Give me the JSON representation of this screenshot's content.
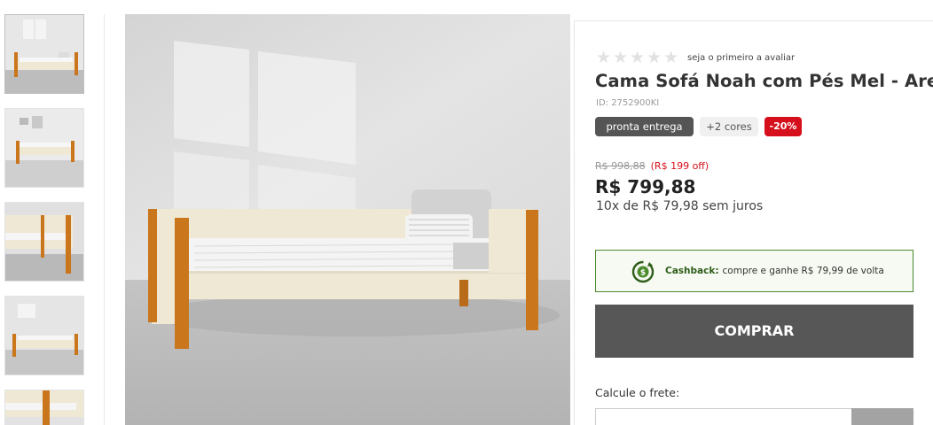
{
  "gallery": {
    "thumbnails": [
      {
        "alt": "thumb-1"
      },
      {
        "alt": "thumb-2"
      },
      {
        "alt": "thumb-3"
      },
      {
        "alt": "thumb-4"
      },
      {
        "alt": "thumb-5"
      }
    ]
  },
  "product": {
    "rating": {
      "stars_filled": 0,
      "stars_total": 5,
      "text": "seja o primeiro a avaliar"
    },
    "title": "Cama Sofá Noah com Pés Mel - Areia",
    "id_text": "ID: 2752900KI",
    "badges": {
      "availability": "pronta entrega",
      "colors": "+2 cores",
      "discount": "-20%"
    },
    "old_price": "R$ 998,88",
    "savings": "(R$ 199 off)",
    "price": "R$ 799,88",
    "installments": "10x de R$ 79,98 sem juros",
    "cashback": {
      "label": "Cashback:",
      "text": "compre e ganhe R$ 79,99 de volta"
    },
    "buy_button": "COMPRAR",
    "freight": {
      "label": "Calcule o frete:",
      "input_value": ""
    }
  },
  "colors": {
    "dark_button": "#575757",
    "discount_red": "#d50f1b",
    "cashback_green": "#4a8a2c",
    "wood": "#c9761d",
    "frame": "#efe8d4"
  }
}
